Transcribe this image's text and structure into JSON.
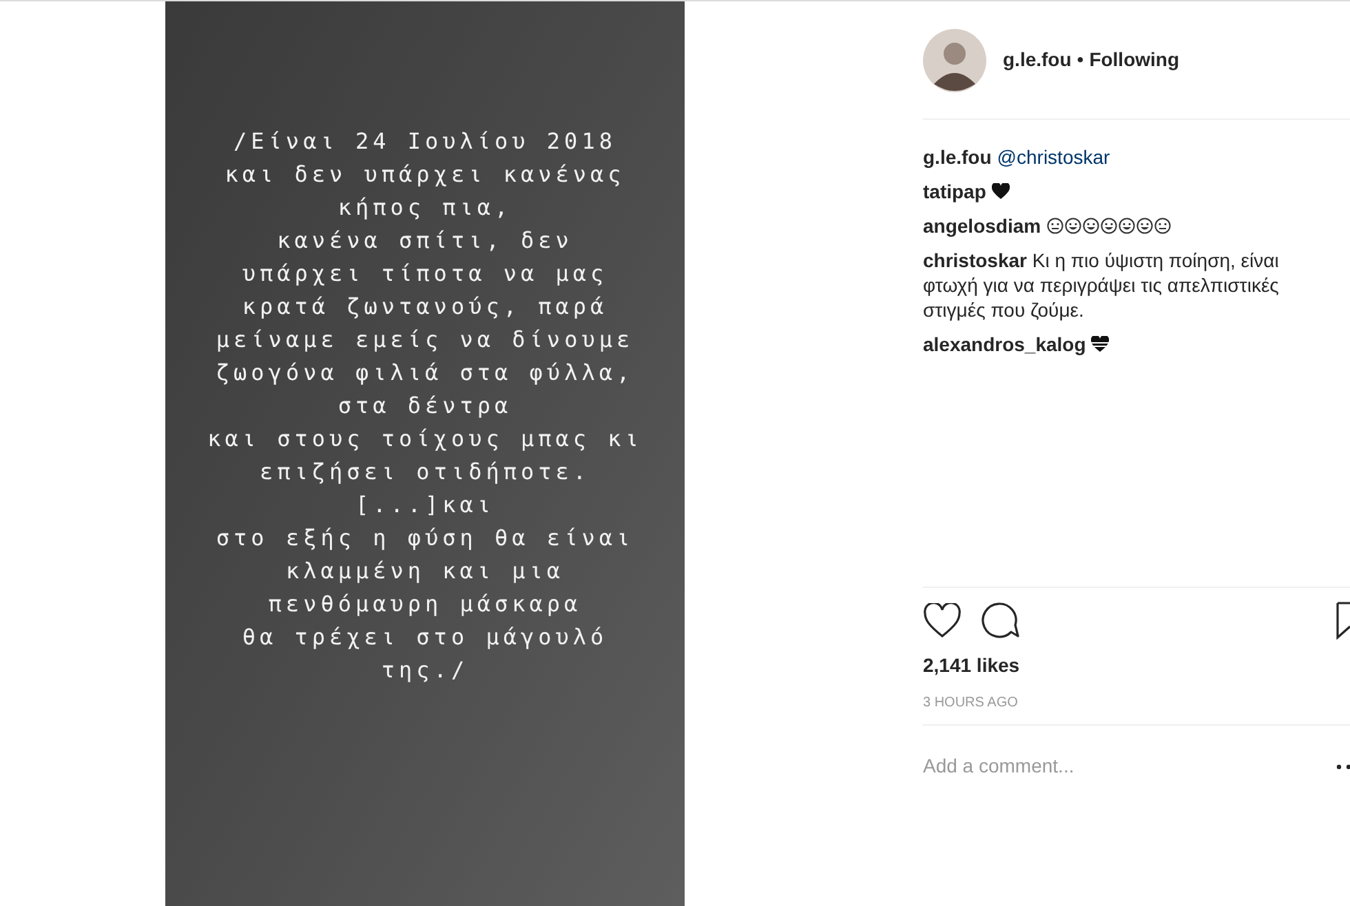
{
  "post_image": {
    "lines": [
      "/Είναι 24 Ιουλίου 2018",
      "και δεν υπάρχει κανένας",
      "κήπος πια,",
      "κανένα σπίτι, δεν",
      "υπάρχει τίποτα να μας",
      "κρατά ζωντανούς, παρά",
      "μείναμε εμείς να δίνουμε",
      "ζωογόνα φιλιά στα φύλλα,",
      "στα δέντρα",
      "και στους τοίχους μπας κι",
      "επιζήσει οτιδήποτε.",
      "[...]και",
      "στο εξής η φύση θα είναι",
      "κλαμμένη και μια",
      "πενθόμαυρη μάσκαρα",
      "θα τρέχει στο μάγουλό",
      "της./"
    ]
  },
  "header": {
    "username": "g.le.fou",
    "separator": "•",
    "follow_label": "Following"
  },
  "comments": [
    {
      "user": "g.le.fou",
      "mention": "@christoskar"
    },
    {
      "user": "tatipap",
      "kind": "heart"
    },
    {
      "user": "angelosdiam",
      "kind": "emoji"
    },
    {
      "user": "christoskar",
      "text": "Κι η πιο ύψιστη ποίηση, είναι φτωχή για να περιγράψει τις απελπιστικές στιγμές που ζούμε."
    },
    {
      "user": "alexandros_kalog",
      "kind": "striped_heart"
    }
  ],
  "likes": "2,141 likes",
  "time": "3 HOURS AGO",
  "comment_field": {
    "placeholder": "Add a comment..."
  }
}
